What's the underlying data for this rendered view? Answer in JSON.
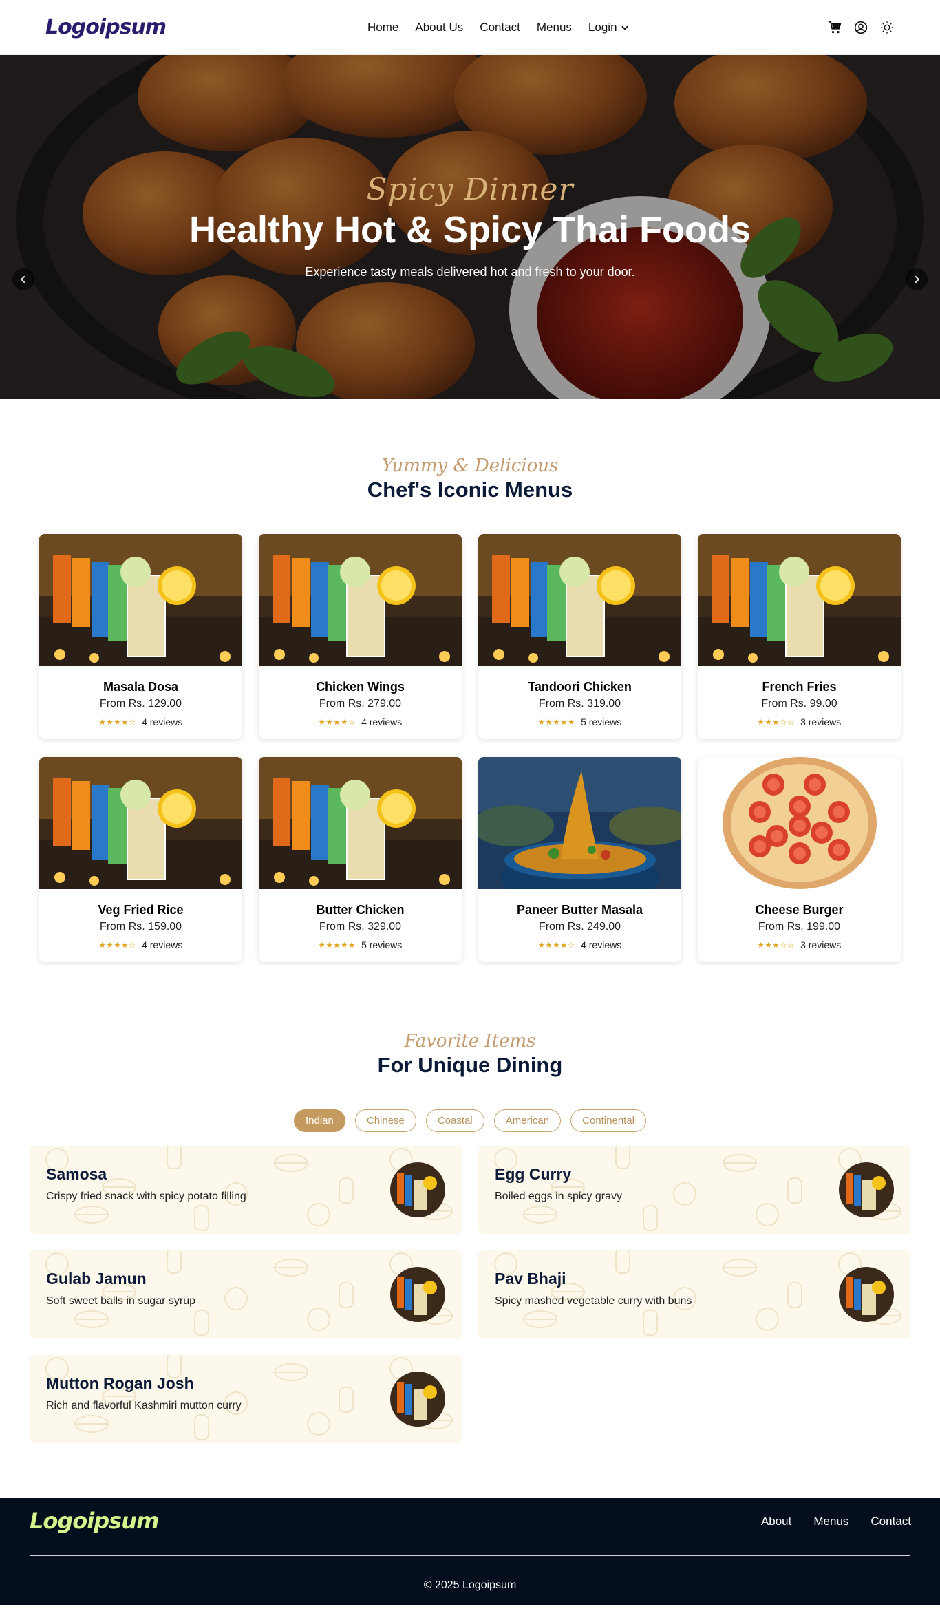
{
  "nav": {
    "logo": "Logoipsum",
    "links": [
      "Home",
      "About Us",
      "Contact",
      "Menus"
    ],
    "login": "Login"
  },
  "hero": {
    "script": "Spicy Dinner",
    "title": "Healthy Hot & Spicy Thai Foods",
    "subtitle": "Experience tasty meals delivered hot and fresh to your door."
  },
  "menus": {
    "script": "Yummy & Delicious",
    "title": "Chef's Iconic Menus",
    "items": [
      {
        "name": "Masala Dosa",
        "price": "From Rs. 129.00",
        "stars": "★★★★☆",
        "reviews": "4 reviews",
        "image": "drinks"
      },
      {
        "name": "Chicken Wings",
        "price": "From Rs. 279.00",
        "stars": "★★★★☆",
        "reviews": "4 reviews",
        "image": "drinks"
      },
      {
        "name": "Tandoori Chicken",
        "price": "From Rs. 319.00",
        "stars": "★★★★★",
        "reviews": "5 reviews",
        "image": "drinks"
      },
      {
        "name": "French Fries",
        "price": "From Rs. 99.00",
        "stars": "★★★☆☆",
        "reviews": "3 reviews",
        "image": "drinks"
      },
      {
        "name": "Veg Fried Rice",
        "price": "From Rs. 159.00",
        "stars": "★★★★☆",
        "reviews": "4 reviews",
        "image": "drinks"
      },
      {
        "name": "Butter Chicken",
        "price": "From Rs. 329.00",
        "stars": "★★★★★",
        "reviews": "5 reviews",
        "image": "drinks"
      },
      {
        "name": "Paneer Butter Masala",
        "price": "From Rs. 249.00",
        "stars": "★★★★☆",
        "reviews": "4 reviews",
        "image": "noodles"
      },
      {
        "name": "Cheese Burger",
        "price": "From Rs. 199.00",
        "stars": "★★★☆☆",
        "reviews": "3 reviews",
        "image": "pizza"
      }
    ]
  },
  "favorites": {
    "script": "Favorite Items",
    "title": "For Unique Dining",
    "tabs": [
      "Indian",
      "Chinese",
      "Coastal",
      "American",
      "Continental"
    ],
    "active_tab": "Indian",
    "items": [
      {
        "name": "Samosa",
        "desc": "Crispy fried snack with spicy potato filling"
      },
      {
        "name": "Egg Curry",
        "desc": "Boiled eggs in spicy gravy"
      },
      {
        "name": "Gulab Jamun",
        "desc": "Soft sweet balls in sugar syrup"
      },
      {
        "name": "Pav Bhaji",
        "desc": "Spicy mashed vegetable curry with buns"
      },
      {
        "name": "Mutton Rogan Josh",
        "desc": "Rich and flavorful Kashmiri mutton curry"
      }
    ]
  },
  "footer": {
    "logo": "Logoipsum",
    "links": [
      "About",
      "Menus",
      "Contact"
    ],
    "copyright": "© 2025 Logoipsum"
  },
  "colors": {
    "accent": "#c49a5e",
    "navy": "#0b1a36",
    "footer_bg": "#050e1c",
    "footer_logo": "#d6f28c",
    "star": "#e0a21a"
  }
}
